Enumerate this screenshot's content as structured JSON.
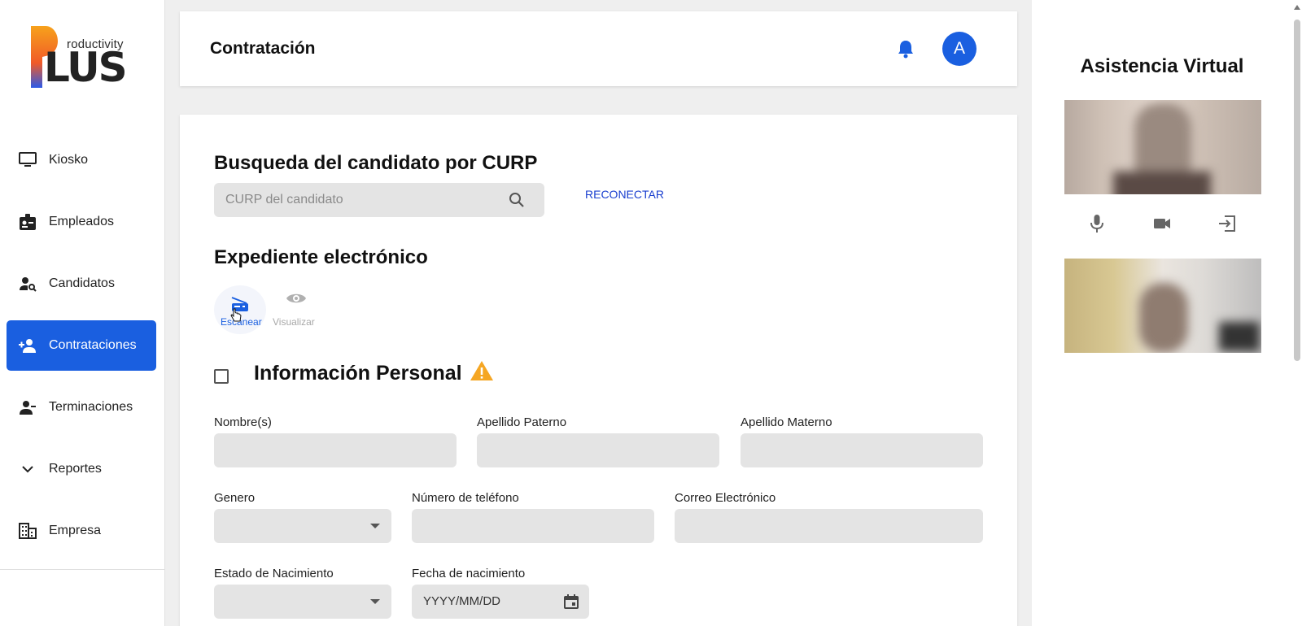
{
  "brand": {
    "logo_word": "roductivity",
    "logo_main": "LUS",
    "colors": {
      "logo_gradient_start": "#f7a21b",
      "logo_gradient_end": "#2b59e8"
    }
  },
  "sidebar": {
    "items": [
      {
        "label": "Kiosko",
        "icon": "monitor-icon",
        "active": false
      },
      {
        "label": "Empleados",
        "icon": "badge-icon",
        "active": false
      },
      {
        "label": "Candidatos",
        "icon": "person-search-icon",
        "active": false
      },
      {
        "label": "Contrataciones",
        "icon": "person-add-icon",
        "active": true
      },
      {
        "label": "Terminaciones",
        "icon": "person-remove-icon",
        "active": false
      },
      {
        "label": "Reportes",
        "icon": "chevron-down-icon",
        "active": false
      },
      {
        "label": "Empresa",
        "icon": "building-icon",
        "active": false
      }
    ],
    "active_color": "#1a5fe0"
  },
  "header": {
    "title": "Contratación",
    "avatar_initial": "A"
  },
  "main": {
    "search_heading": "Busqueda del candidato por CURP",
    "search_placeholder": "CURP del candidato",
    "reconnect_label": "RECONECTAR",
    "expediente_heading": "Expediente electrónico",
    "scan_label": "Escanear",
    "view_label": "Visualizar",
    "personal_heading": "Información Personal",
    "warning_color": "#f5a623",
    "fields": {
      "nombre": {
        "label": "Nombre(s)",
        "value": ""
      },
      "apellido_paterno": {
        "label": "Apellido Paterno",
        "value": ""
      },
      "apellido_materno": {
        "label": "Apellido Materno",
        "value": ""
      },
      "genero": {
        "label": "Genero",
        "value": ""
      },
      "telefono": {
        "label": "Número de teléfono",
        "value": ""
      },
      "correo": {
        "label": "Correo Electrónico",
        "value": ""
      },
      "estado_nacimiento": {
        "label": "Estado de Nacimiento",
        "value": ""
      },
      "fecha_nacimiento": {
        "label": "Fecha de nacimiento",
        "value": "YYYY/MM/DD"
      }
    }
  },
  "assist": {
    "title": "Asistencia Virtual",
    "controls": [
      "mic-icon",
      "camera-icon",
      "exit-icon"
    ]
  }
}
